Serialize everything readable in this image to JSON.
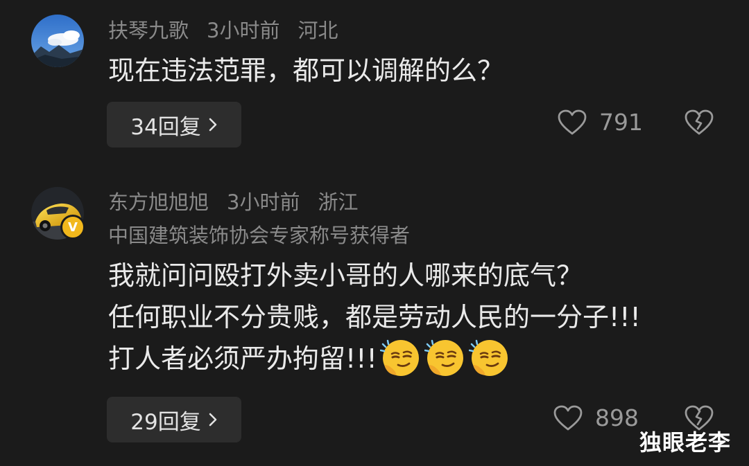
{
  "comments": [
    {
      "avatar": "sky-clouds-mountain-avatar",
      "username": "扶琴九歌",
      "time": "3小时前",
      "location": "河北",
      "lines": [
        "现在违法范罪，都可以调解的么？"
      ],
      "reply_label": "34回复",
      "likes": "791"
    },
    {
      "avatar": "yellow-car-avatar",
      "verified_badge": "V",
      "username": "东方旭旭旭",
      "time": "3小时前",
      "location": "浙江",
      "title": "中国建筑装饰协会专家称号获得者",
      "lines": [
        "我就问问殴打外卖小哥的人哪来的底气？",
        "任何职业不分贵贱，都是劳动人民的一分子!!!",
        "打人者必须严办拘留!!!"
      ],
      "emojis": [
        "smirk-thinking-emoji",
        "smirk-thinking-emoji",
        "smirk-thinking-emoji"
      ],
      "reply_label": "29回复",
      "likes": "898"
    }
  ],
  "icons": {
    "reply_chevron": "chevron-right-icon",
    "like": "heart-outline-icon",
    "dislike": "broken-heart-icon"
  },
  "colors": {
    "background": "#1b1b1b",
    "meta_text": "#8a8a8a",
    "body_text": "#eaeaea",
    "reply_bg": "#2d2d2d",
    "badge": "#f2b81c"
  },
  "watermark": "独眼老李"
}
